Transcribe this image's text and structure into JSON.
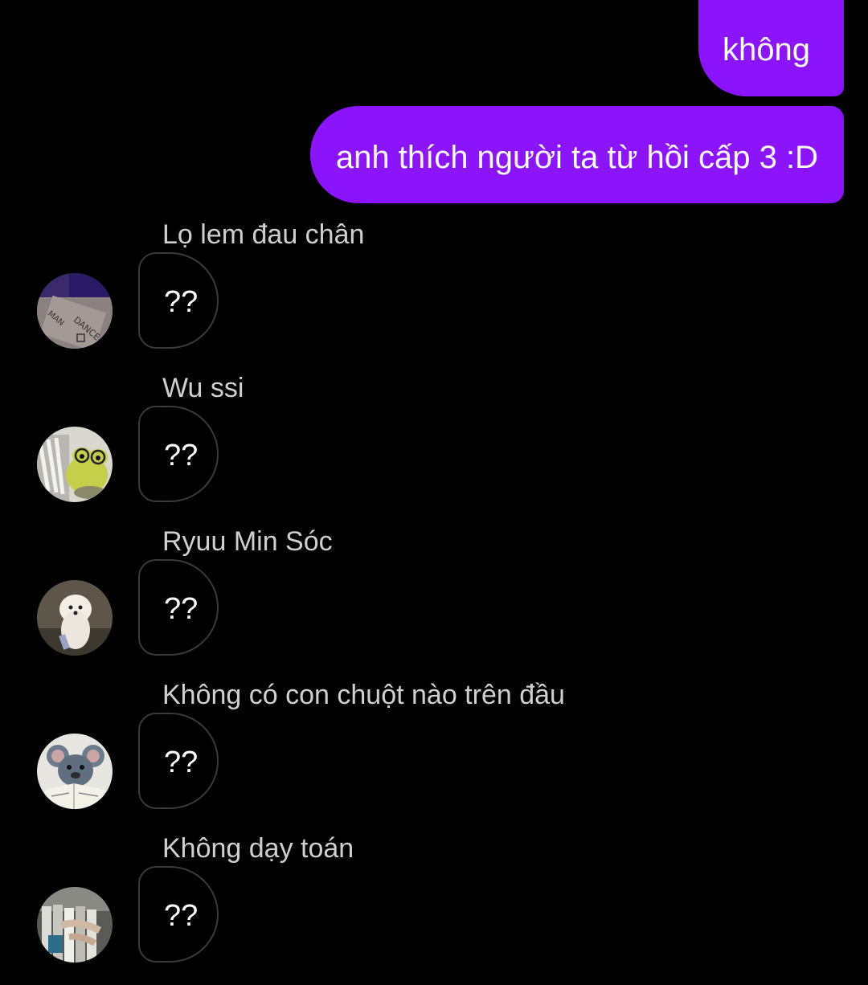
{
  "messages": {
    "sent": [
      {
        "text": "không"
      },
      {
        "text": "anh thích người ta từ hồi cấp 3 :D"
      }
    ],
    "received": [
      {
        "sender": "Lọ lem đau chân",
        "text": "??",
        "avatar": "dance-photo-avatar"
      },
      {
        "sender": "Wu ssi",
        "text": "??",
        "avatar": "frog-plush-avatar"
      },
      {
        "sender": "Ryuu Min Sóc",
        "text": "??",
        "avatar": "white-dog-avatar"
      },
      {
        "sender": "Không có con chuột nào trên đầu",
        "text": "??",
        "avatar": "rat-cartoon-avatar"
      },
      {
        "sender": "Không dạy toán",
        "text": "??",
        "avatar": "record-shop-avatar"
      }
    ]
  },
  "colors": {
    "background": "#000000",
    "sent_bubble": "#8c14fc",
    "received_border": "#3a3a3a",
    "sender_name": "#cfcfcf"
  }
}
